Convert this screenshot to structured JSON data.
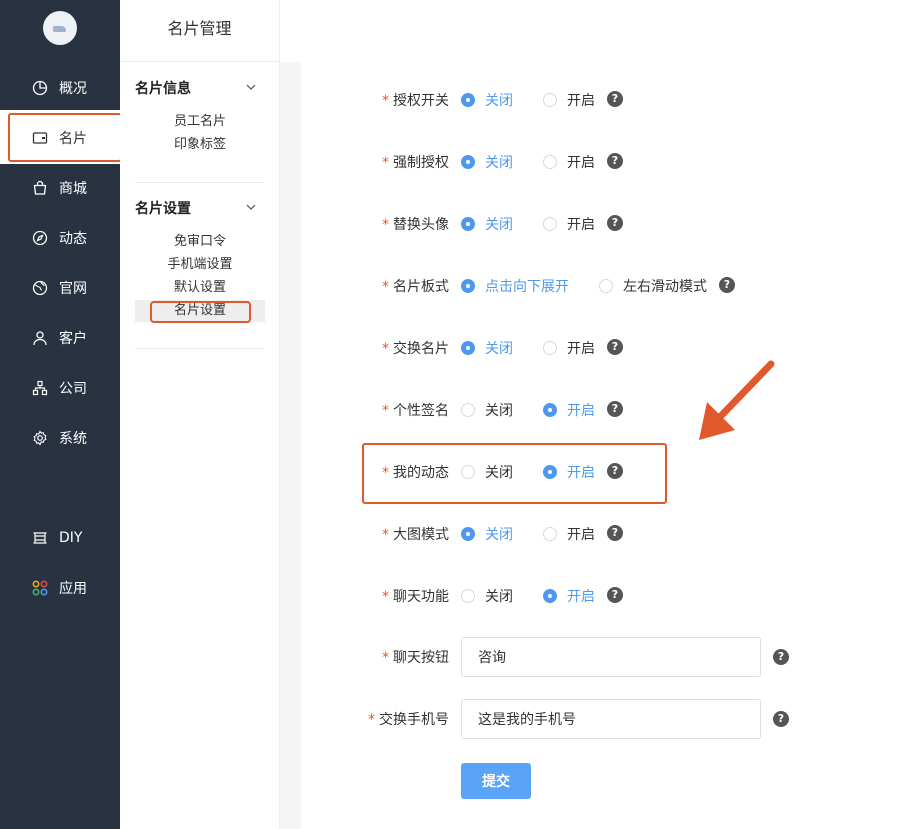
{
  "nav": {
    "items": [
      {
        "label": "概况",
        "icon": "pie-chart-icon"
      },
      {
        "label": "名片",
        "icon": "wallet-icon"
      },
      {
        "label": "商城",
        "icon": "shopping-bag-icon"
      },
      {
        "label": "动态",
        "icon": "compass-icon"
      },
      {
        "label": "官网",
        "icon": "globe-icon"
      },
      {
        "label": "客户",
        "icon": "user-icon"
      },
      {
        "label": "公司",
        "icon": "org-chart-icon"
      },
      {
        "label": "系统",
        "icon": "gear-icon"
      },
      {
        "label": "DIY",
        "icon": "diy-icon"
      },
      {
        "label": "应用",
        "icon": "apps-icon"
      }
    ],
    "active": "名片"
  },
  "sub": {
    "title": "名片管理",
    "groups": [
      {
        "title": "名片信息",
        "links": [
          "员工名片",
          "印象标签"
        ]
      },
      {
        "title": "名片设置",
        "links": [
          "免审口令",
          "手机端设置",
          "默认设置",
          "名片设置"
        ]
      }
    ],
    "active_link": "名片设置"
  },
  "form": {
    "rows": [
      {
        "label": "授权开关",
        "options": [
          "关闭",
          "开启"
        ],
        "selected": 0
      },
      {
        "label": "强制授权",
        "options": [
          "关闭",
          "开启"
        ],
        "selected": 0
      },
      {
        "label": "替换头像",
        "options": [
          "关闭",
          "开启"
        ],
        "selected": 0
      },
      {
        "label": "名片板式",
        "options": [
          "点击向下展开",
          "左右滑动模式"
        ],
        "selected": 0
      },
      {
        "label": "交换名片",
        "options": [
          "关闭",
          "开启"
        ],
        "selected": 0
      },
      {
        "label": "个性签名",
        "options": [
          "关闭",
          "开启"
        ],
        "selected": 1
      },
      {
        "label": "我的动态",
        "options": [
          "关闭",
          "开启"
        ],
        "selected": 1
      },
      {
        "label": "大图模式",
        "options": [
          "关闭",
          "开启"
        ],
        "selected": 0
      },
      {
        "label": "聊天功能",
        "options": [
          "关闭",
          "开启"
        ],
        "selected": 1
      }
    ],
    "inputs": [
      {
        "label": "聊天按钮",
        "value": "咨询"
      },
      {
        "label": "交换手机号",
        "value": "这是我的手机号"
      }
    ],
    "required_mark": "*",
    "help_glyph": "?",
    "submit_label": "提交"
  },
  "colors": {
    "sidebar_bg": "#283241",
    "accent_blue": "#4f98ef",
    "highlight_red": "#e2582d"
  }
}
